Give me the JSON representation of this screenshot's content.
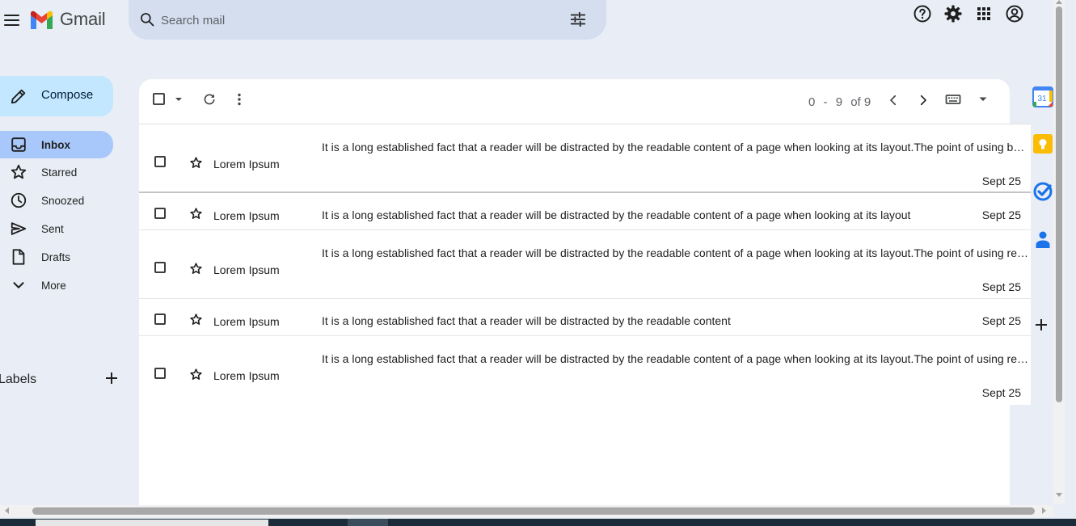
{
  "app": {
    "name": "Gmail"
  },
  "search": {
    "placeholder": "Search mail"
  },
  "colors": {
    "background": "#e9eef6",
    "compose_bg": "#c2e7ff",
    "active_nav_bg": "#a8c7fa",
    "search_bg": "#d4deef",
    "panel_bg": "#ffffff"
  },
  "header_icons": [
    "help-icon",
    "settings-gear-icon",
    "apps-grid-icon",
    "account-icon"
  ],
  "sidebar": {
    "compose_label": "Compose",
    "items": [
      {
        "label": "Inbox",
        "icon": "inbox-icon",
        "active": true
      },
      {
        "label": "Starred",
        "icon": "star-icon",
        "active": false
      },
      {
        "label": "Snoozed",
        "icon": "clock-icon",
        "active": false
      },
      {
        "label": "Sent",
        "icon": "send-icon",
        "active": false
      },
      {
        "label": "Drafts",
        "icon": "draft-icon",
        "active": false
      },
      {
        "label": "More",
        "icon": "chevron-down-icon",
        "active": false
      }
    ],
    "labels_title": "Labels"
  },
  "toolbar": {
    "pager": {
      "start": "0",
      "dash": "-",
      "end": "9",
      "of_text": "of 9"
    }
  },
  "emails": [
    {
      "sender": "Lorem Ipsum",
      "snippet": "It is a long established fact that a reader will be distracted by the readable content of a page when looking at its layout.The point of using b…",
      "date": "Sept 25"
    },
    {
      "sender": "Lorem Ipsum",
      "snippet": "It is a long established fact that a reader will be distracted by the readable content of a page when looking at its layout",
      "date": "Sept 25"
    },
    {
      "sender": "Lorem Ipsum",
      "snippet": "It is a long established fact that a reader will be distracted by the readable content of a page when looking at its layout.The point of using re…",
      "date": "Sept 25"
    },
    {
      "sender": "Lorem Ipsum",
      "snippet": "It is a long established fact that a reader will be distracted by the readable content",
      "date": "Sept 25"
    },
    {
      "sender": "Lorem Ipsum",
      "snippet": "It is a long established fact that a reader will be distracted by the readable content of a page when looking at its layout.The point of using re…",
      "date": "Sept 25"
    }
  ],
  "side_panel": {
    "apps": [
      "calendar-icon",
      "keep-icon",
      "tasks-icon",
      "contacts-icon"
    ],
    "calendar_day": "31"
  }
}
